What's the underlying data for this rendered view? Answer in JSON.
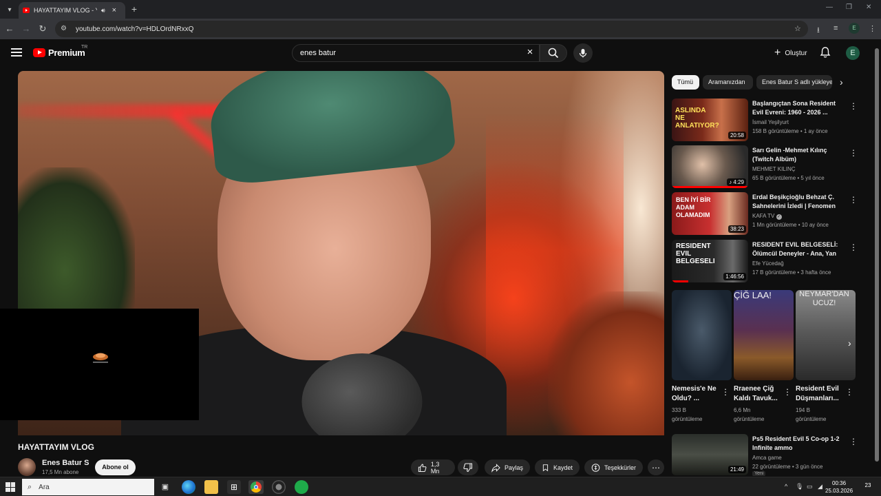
{
  "browser": {
    "tab_title": "HAYATTAYIM VLOG - YouTube",
    "url": "youtube.com/watch?v=HDLOrdNRxxQ",
    "profile_initial": "E"
  },
  "masthead": {
    "logo_text": "Premium",
    "country_code": "TR",
    "search_value": "enes batur",
    "create_label": "Oluştur",
    "avatar_initial": "E"
  },
  "video": {
    "title": "HAYATTAYIM VLOG",
    "channel_name": "Enes Batur S",
    "subscribers": "17,5 Mn abone",
    "subscribe_label": "Abone ol",
    "likes": "1,3 Mn",
    "share_label": "Paylaş",
    "save_label": "Kaydet",
    "thanks_label": "Teşekkürler"
  },
  "chips": [
    "Tümü",
    "Aramanızdan",
    "Enes Batur S adlı yükleyen"
  ],
  "recommendations": [
    {
      "title": "Başlangıçtan Sona Resident Evil Evreni: 1960 - 2026 ...",
      "channel": "İsmail Yeşilyurt",
      "meta": "158 B görüntüleme • 1 ay önce",
      "duration": "20:58",
      "thumb_text": "ASLINDA NE ANLATIYOR?",
      "progress": 0,
      "verified": false
    },
    {
      "title": "Sarı Gelin -Mehmet Kılınç (Twitch Albüm)",
      "channel": "MEHMET KILINÇ",
      "meta": "65 B görüntüleme • 5 yıl önce",
      "duration": "4:29",
      "thumb_text": "",
      "progress": 1.0,
      "verified": false
    },
    {
      "title": "Erdal Beşikçioğlu Behzat Ç. Sahnelerini İzledi | Fenomen",
      "channel": "KAFA TV",
      "meta": "1 Mn görüntüleme • 10 ay önce",
      "duration": "38:23",
      "thumb_text": "BEN İYİ BİR ADAM OLAMADIM",
      "progress": 0,
      "verified": true
    },
    {
      "title": "RESIDENT EVIL BELGESELİ: Ölümcül Deneyler - Ana, Yan ...",
      "channel": "Efe Yücedağ",
      "meta": "17 B görüntüleme • 3 hafta önce",
      "duration": "1:46:56",
      "thumb_text": "RESIDENT EVIL BELGESELI",
      "progress": 0.22,
      "verified": false
    }
  ],
  "shorts": [
    {
      "title": "Nemesis'e Ne Oldu? ...",
      "views": "333 B görüntüleme",
      "thumb_text": ""
    },
    {
      "title": "Rraenee Çiğ Kaldı Tavuk...",
      "views": "6,6 Mn görüntüleme",
      "thumb_text": "ÇİĞ LAA!"
    },
    {
      "title": "Resident Evil Düşmanları...",
      "views": "194 B görüntüleme",
      "thumb_text": "NEYMAR'DAN UCUZ!"
    }
  ],
  "bottom_rec": {
    "title": "Ps5 Resident Evil 5 Co-op 1-2 Infinite ammo",
    "channel": "Amca game",
    "meta": "22 görüntüleme • 3 gün önce",
    "duration": "21:49",
    "badge": "Yeni"
  },
  "taskbar": {
    "search_placeholder": "Ara",
    "time": "00:36",
    "date": "25.03.2026",
    "notif_count": "23"
  }
}
